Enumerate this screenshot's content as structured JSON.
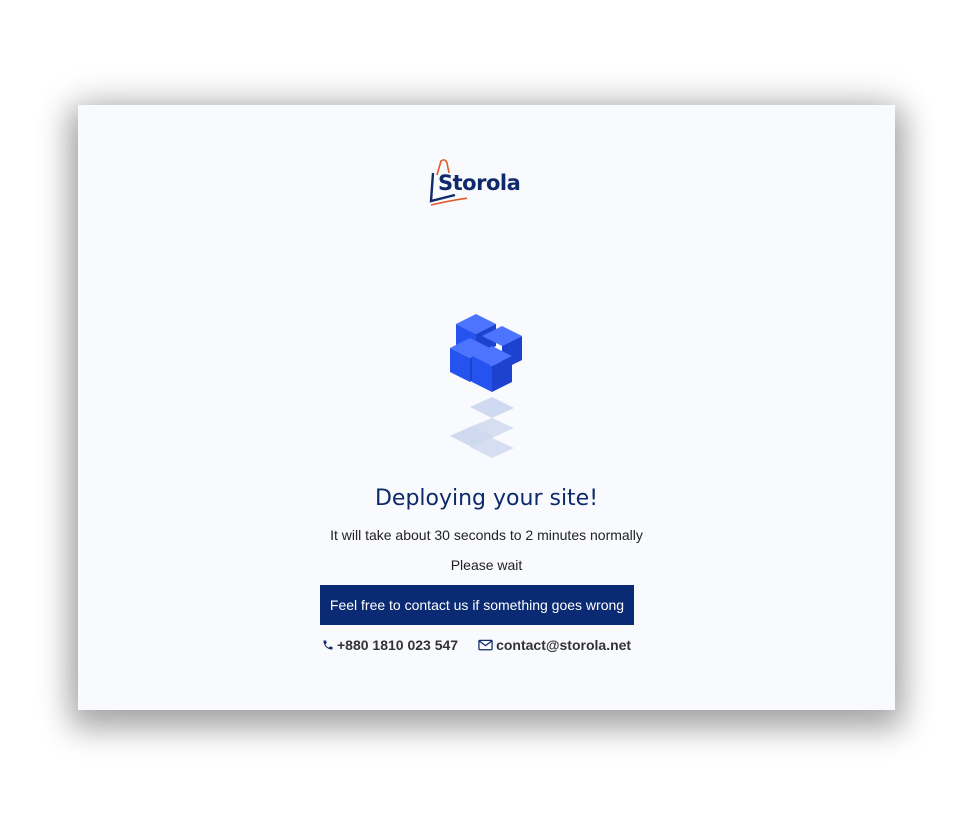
{
  "brand": {
    "name": "Storola",
    "primary_color": "#0e2a6b",
    "accent_color": "#e05a2a"
  },
  "status": {
    "heading": "Deploying your site!",
    "subtitle": "It will take about 30 seconds to 2 minutes normally",
    "wait": "Please wait"
  },
  "contact": {
    "banner": "Feel free to contact us if something goes wrong",
    "phone": "+880 1810 023 547",
    "email": "contact@storola.net",
    "phone_icon": "phone-icon",
    "email_icon": "envelope-icon"
  },
  "illustration": {
    "icon": "stacked-cubes-icon",
    "cube_color": "#2553f0",
    "shadow_color": "#cfd9ef"
  }
}
